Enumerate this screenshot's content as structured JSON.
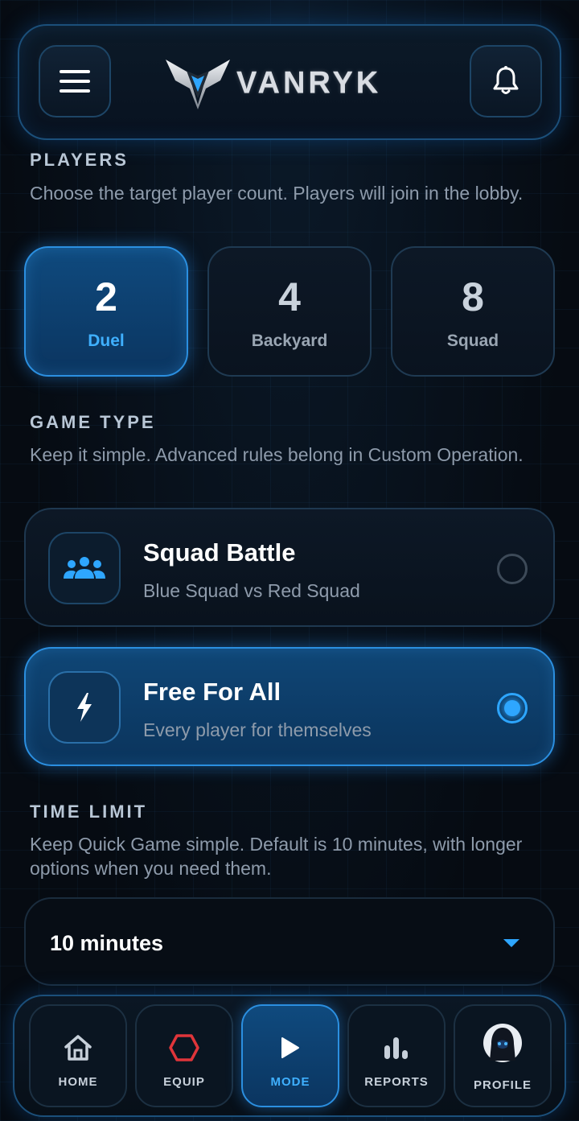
{
  "header": {
    "brand": "VANRYK",
    "menu_icon": "hamburger-menu-icon",
    "notification_icon": "bell-icon"
  },
  "players": {
    "title": "PLAYERS",
    "description": "Choose the target player count. Players will join in the lobby.",
    "options": [
      {
        "count": "2",
        "label": "Duel",
        "selected": true
      },
      {
        "count": "4",
        "label": "Backyard",
        "selected": false
      },
      {
        "count": "8",
        "label": "Squad",
        "selected": false
      }
    ]
  },
  "game_type": {
    "title": "GAME TYPE",
    "description": "Keep it simple. Advanced rules belong in Custom Operation.",
    "options": [
      {
        "title": "Squad Battle",
        "subtitle": "Blue Squad vs Red Squad",
        "icon": "group-icon",
        "selected": false
      },
      {
        "title": "Free For All",
        "subtitle": "Every player for themselves",
        "icon": "lightning-icon",
        "selected": true
      }
    ]
  },
  "time_limit": {
    "title": "TIME LIMIT",
    "description": "Keep Quick Game simple. Default is 10 minutes, with longer options when you need them.",
    "selected": "10 minutes"
  },
  "nav": {
    "items": [
      {
        "label": "HOME",
        "icon": "home-icon"
      },
      {
        "label": "EQUIP",
        "icon": "hexagon-icon"
      },
      {
        "label": "MODE",
        "icon": "play-icon",
        "selected": true
      },
      {
        "label": "REPORTS",
        "icon": "bar-chart-icon"
      },
      {
        "label": "PROFILE",
        "icon": "avatar"
      }
    ]
  },
  "colors": {
    "accent": "#2ea6ff",
    "background": "#060b12",
    "selected_fill": "#0f4a7e",
    "equip_icon": "#e0353a"
  }
}
